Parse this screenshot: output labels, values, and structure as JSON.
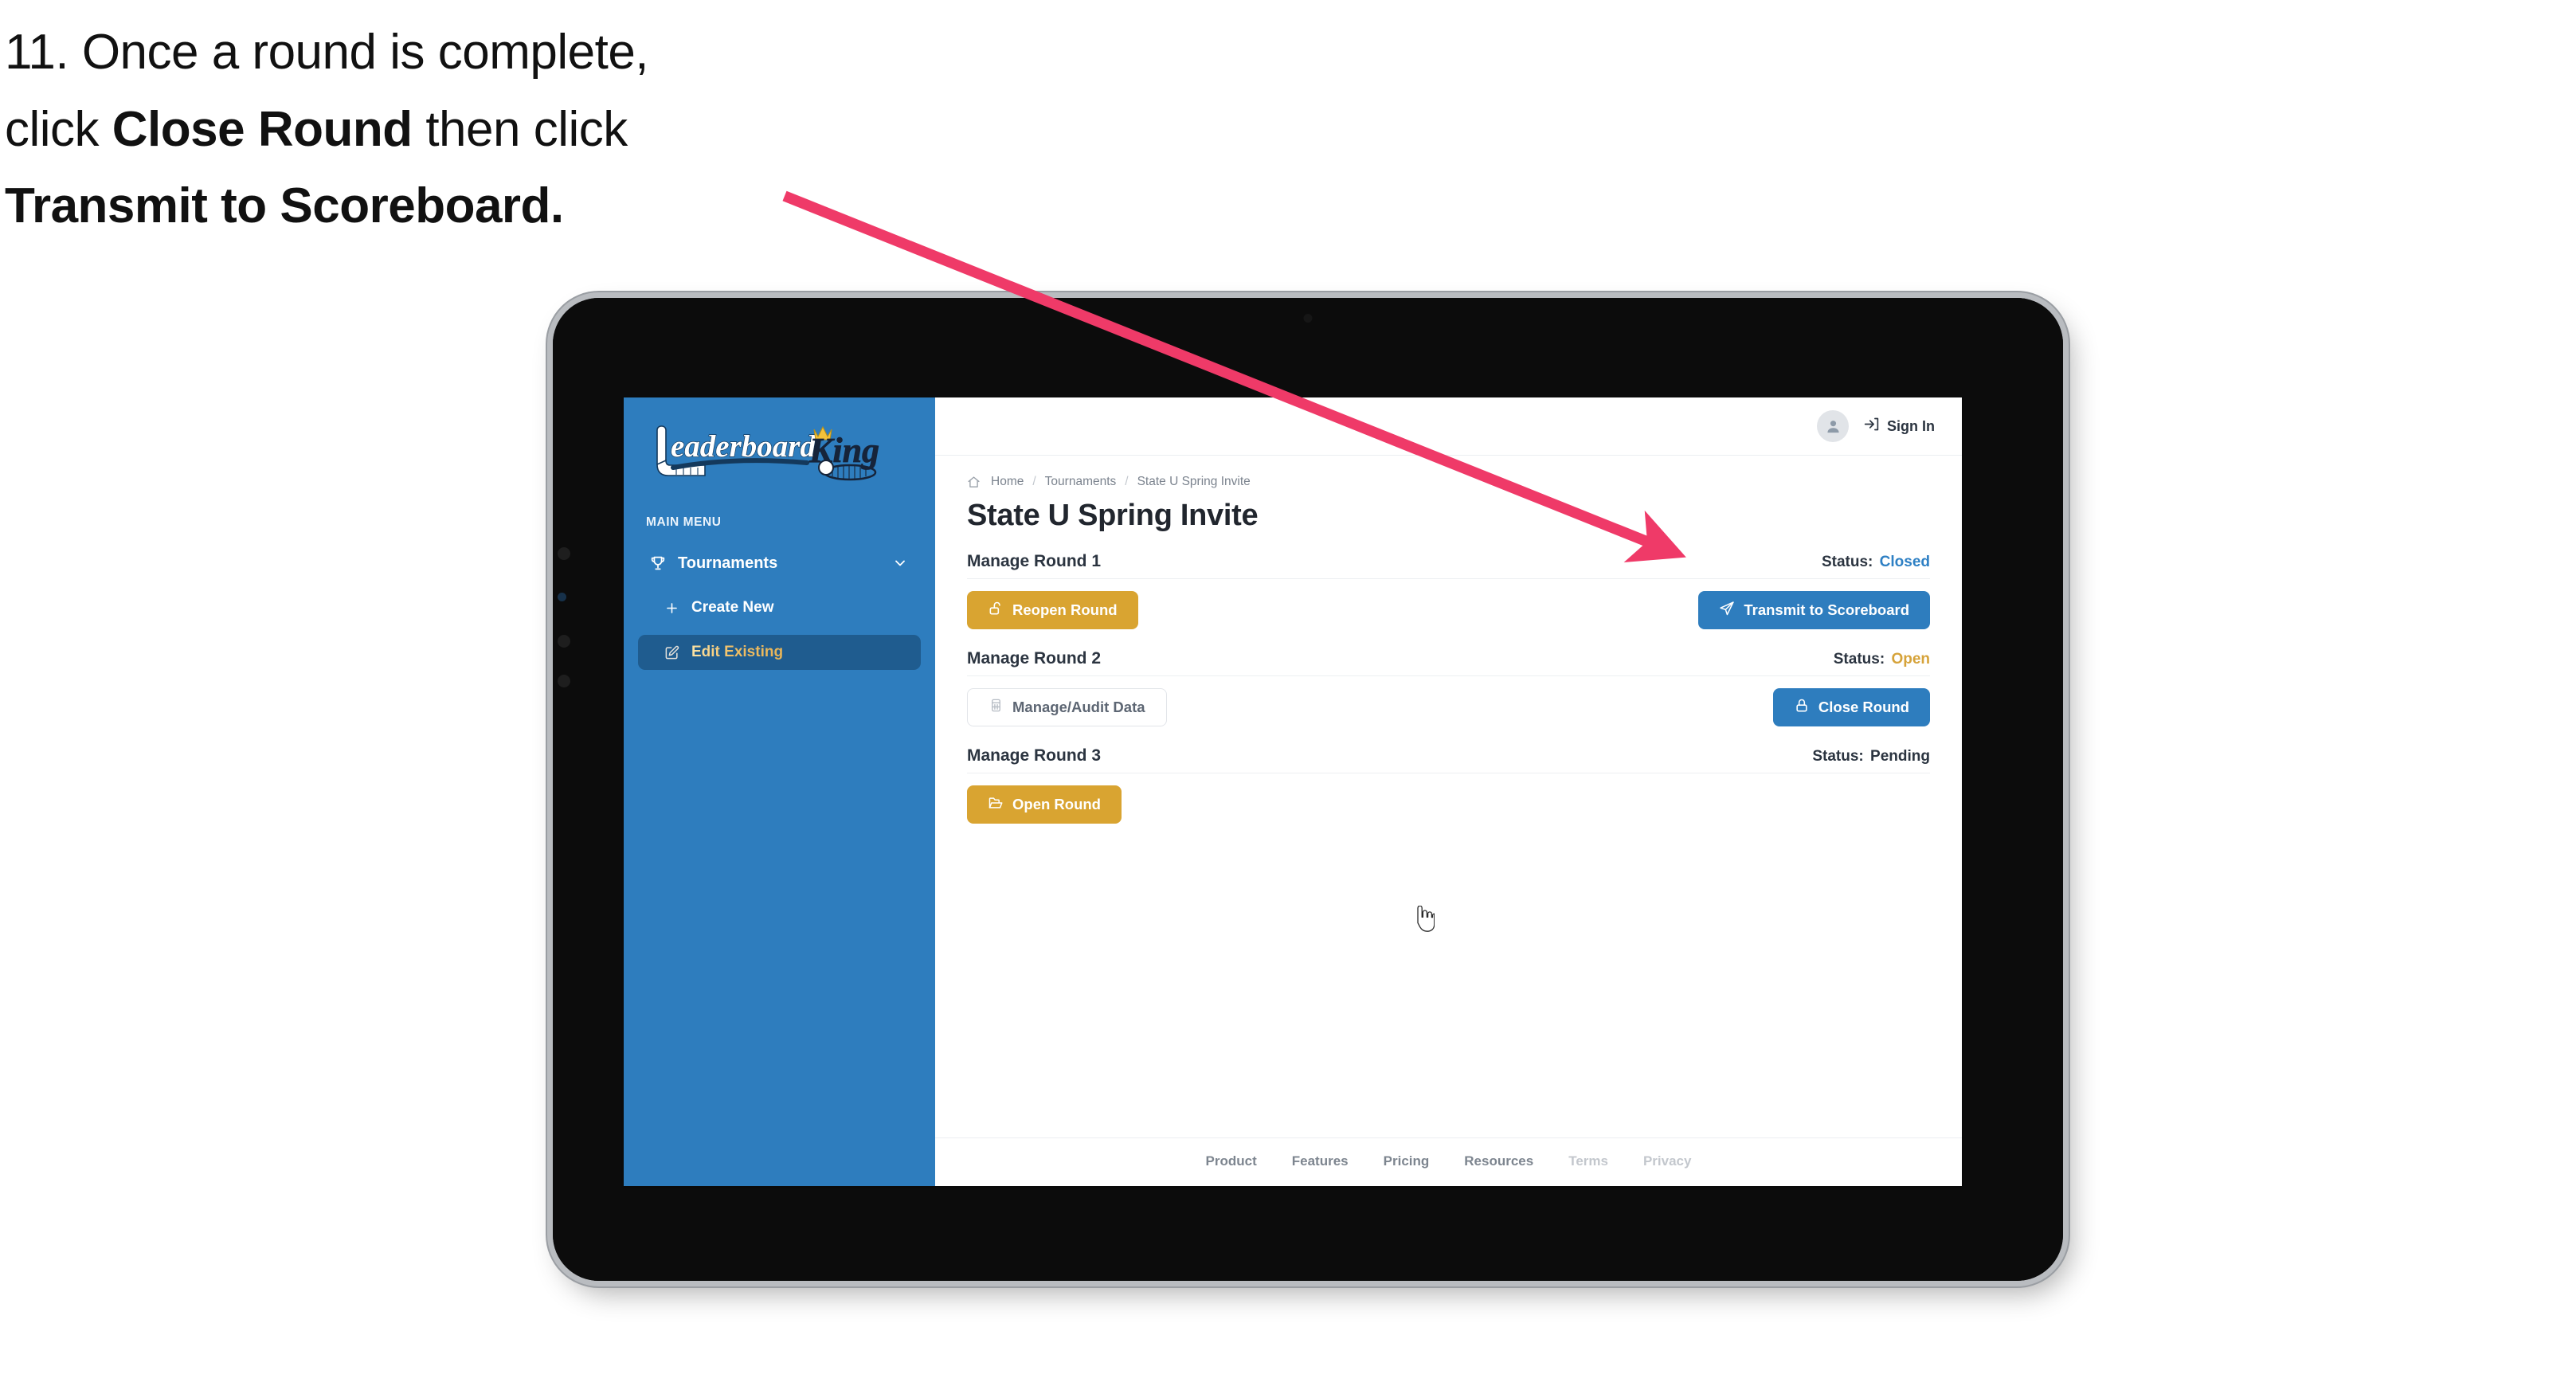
{
  "caption": {
    "line1_plain": "11. Once a round is complete,",
    "line2_pre": "click ",
    "line2_bold": "Close Round",
    "line2_post": " then click",
    "line3_bold": "Transmit to Scoreboard."
  },
  "annotation": {
    "arrow_color": "#ef3a68",
    "arrow_target": "transmit-to-scoreboard-button"
  },
  "app": {
    "sidebar": {
      "logo_primary": "Leaderboard",
      "logo_secondary": "King",
      "menu_label": "MAIN MENU",
      "items": [
        {
          "label": "Tournaments",
          "icon": "trophy-icon",
          "chevron": "chevron-down-icon",
          "active": false
        },
        {
          "label": "Create New",
          "icon": "plus-icon",
          "active": false
        },
        {
          "label": "Edit Existing",
          "icon": "edit-pencil-icon",
          "active": true
        }
      ],
      "bg_color": "#2e7dbe",
      "active_bg_color": "#1f5c8f",
      "active_text_color": "#f0bf66"
    },
    "topbar": {
      "avatar_icon": "user-avatar-icon",
      "signin_icon": "sign-in-arrow-icon",
      "signin_label": "Sign In"
    },
    "breadcrumb": {
      "home_icon": "home-icon",
      "items": [
        "Home",
        "Tournaments",
        "State U Spring Invite"
      ],
      "separator": "/"
    },
    "page_title": "State U Spring Invite",
    "status_label": "Status:",
    "rounds": [
      {
        "title": "Manage Round 1",
        "status_value": "Closed",
        "status_class": "status-closed",
        "left_button": {
          "label": "Reopen Round",
          "icon": "unlock-icon",
          "style": "btn-gold"
        },
        "right_button": {
          "label": "Transmit to Scoreboard",
          "icon": "send-paper-plane-icon",
          "style": "btn-blue"
        }
      },
      {
        "title": "Manage Round 2",
        "status_value": "Open",
        "status_class": "status-open",
        "left_button": {
          "label": "Manage/Audit Data",
          "icon": "table-grid-icon",
          "style": "btn-ghost"
        },
        "right_button": {
          "label": "Close Round",
          "icon": "lock-icon",
          "style": "btn-blue"
        }
      },
      {
        "title": "Manage Round 3",
        "status_value": "Pending",
        "status_class": "status-pending",
        "left_button": {
          "label": "Open Round",
          "icon": "folder-open-icon",
          "style": "btn-gold"
        },
        "right_button": null
      }
    ],
    "footer_links": [
      {
        "label": "Product",
        "muted": false
      },
      {
        "label": "Features",
        "muted": false
      },
      {
        "label": "Pricing",
        "muted": false
      },
      {
        "label": "Resources",
        "muted": false
      },
      {
        "label": "Terms",
        "muted": true
      },
      {
        "label": "Privacy",
        "muted": true
      }
    ],
    "cursor": "hand-pointer-cursor"
  }
}
